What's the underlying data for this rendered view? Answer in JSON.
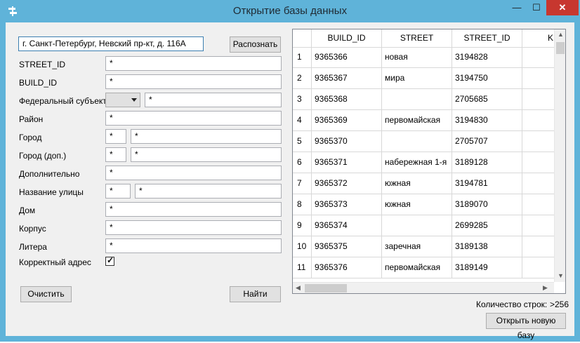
{
  "window": {
    "title": "Открытие базы данных",
    "minimize_glyph": "—",
    "maximize_glyph": "☐",
    "close_glyph": "✕"
  },
  "address": {
    "value": "г. Санкт-Петербург, Невский пр-кт, д. 116А",
    "recognize_label": "Распознать"
  },
  "form": {
    "street_id": {
      "label": "STREET_ID",
      "value": "*"
    },
    "build_id": {
      "label": "BUILD_ID",
      "value": "*"
    },
    "federal_subject": {
      "label": "Федеральный субъект",
      "combo_value": "",
      "value": "*"
    },
    "district": {
      "label": "Район",
      "value": "*"
    },
    "city": {
      "label": "Город",
      "prefix": "*",
      "value": "*"
    },
    "city_extra": {
      "label": "Город (доп.)",
      "prefix": "*",
      "value": "*"
    },
    "additional": {
      "label": "Дополнительно",
      "value": "*"
    },
    "street_name": {
      "label": "Название улицы",
      "prefix": "*",
      "value": "*"
    },
    "house": {
      "label": "Дом",
      "value": "*"
    },
    "building": {
      "label": "Корпус",
      "value": "*"
    },
    "letter": {
      "label": "Литера",
      "value": "*"
    },
    "correct_address": {
      "label": "Корректный адрес",
      "checked": true
    }
  },
  "buttons": {
    "clear": "Очистить",
    "find": "Найти",
    "open_new_db": "Открыть новую базу"
  },
  "table": {
    "columns": [
      "BUILD_ID",
      "STREET",
      "STREET_ID",
      "K"
    ],
    "rows": [
      {
        "num": "1",
        "build_id": "9365366",
        "street": "новая",
        "street_id": "3194828"
      },
      {
        "num": "2",
        "build_id": "9365367",
        "street": "мира",
        "street_id": "3194750"
      },
      {
        "num": "3",
        "build_id": "9365368",
        "street": "",
        "street_id": "2705685"
      },
      {
        "num": "4",
        "build_id": "9365369",
        "street": "первомайская",
        "street_id": "3194830"
      },
      {
        "num": "5",
        "build_id": "9365370",
        "street": "",
        "street_id": "2705707"
      },
      {
        "num": "6",
        "build_id": "9365371",
        "street": "набережная 1-я",
        "street_id": "3189128"
      },
      {
        "num": "7",
        "build_id": "9365372",
        "street": "южная",
        "street_id": "3194781"
      },
      {
        "num": "8",
        "build_id": "9365373",
        "street": "южная",
        "street_id": "3189070"
      },
      {
        "num": "9",
        "build_id": "9365374",
        "street": "",
        "street_id": "2699285"
      },
      {
        "num": "10",
        "build_id": "9365375",
        "street": "заречная",
        "street_id": "3189138"
      },
      {
        "num": "11",
        "build_id": "9365376",
        "street": "первомайская",
        "street_id": "3189149"
      }
    ]
  },
  "status": {
    "row_count_label": "Количество строк:",
    "row_count_value": ">256"
  },
  "colors": {
    "titlebar": "#5fb3d9",
    "close_button": "#c7372f",
    "client_bg": "#f0f0f0"
  }
}
